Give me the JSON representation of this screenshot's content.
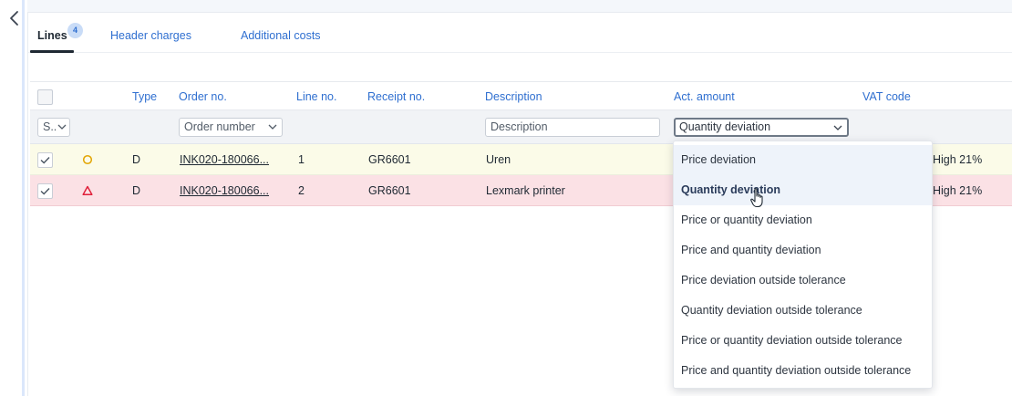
{
  "tabs": [
    {
      "label": "Lines",
      "badge": "4"
    },
    {
      "label": "Header charges"
    },
    {
      "label": "Additional costs"
    }
  ],
  "columns": {
    "type": "Type",
    "order_no": "Order no.",
    "line_no": "Line no.",
    "receipt_no": "Receipt no.",
    "description": "Description",
    "act_amount": "Act. amount",
    "vat_code": "VAT code"
  },
  "filters": {
    "status": "S..",
    "order_number_placeholder": "Order number",
    "description_placeholder": "Description",
    "act_amount_value": "Quantity deviation"
  },
  "rows": [
    {
      "status_icon": "circle-icon",
      "status_color": "#e2a400",
      "type": "D",
      "order_no": "INK020-180066...",
      "line_no": "1",
      "receipt_no": "GR6601",
      "description": "Uren",
      "vat": "High 21%"
    },
    {
      "status_icon": "triangle-warning-icon",
      "status_color": "#e0203a",
      "type": "D",
      "order_no": "INK020-180066...",
      "line_no": "2",
      "receipt_no": "GR6601",
      "description": "Lexmark printer",
      "vat": "High 21%"
    }
  ],
  "dropdown_options": [
    "Price deviation",
    "Quantity deviation",
    "Price or quantity deviation",
    "Price and quantity deviation",
    "Price deviation outside tolerance",
    "Quantity deviation outside tolerance",
    "Price or quantity deviation outside tolerance",
    "Price and quantity deviation outside tolerance"
  ],
  "colors": {
    "accent": "#2f6fd0",
    "row_warning": "#fbfbe8",
    "row_error": "#fbe1e5"
  }
}
